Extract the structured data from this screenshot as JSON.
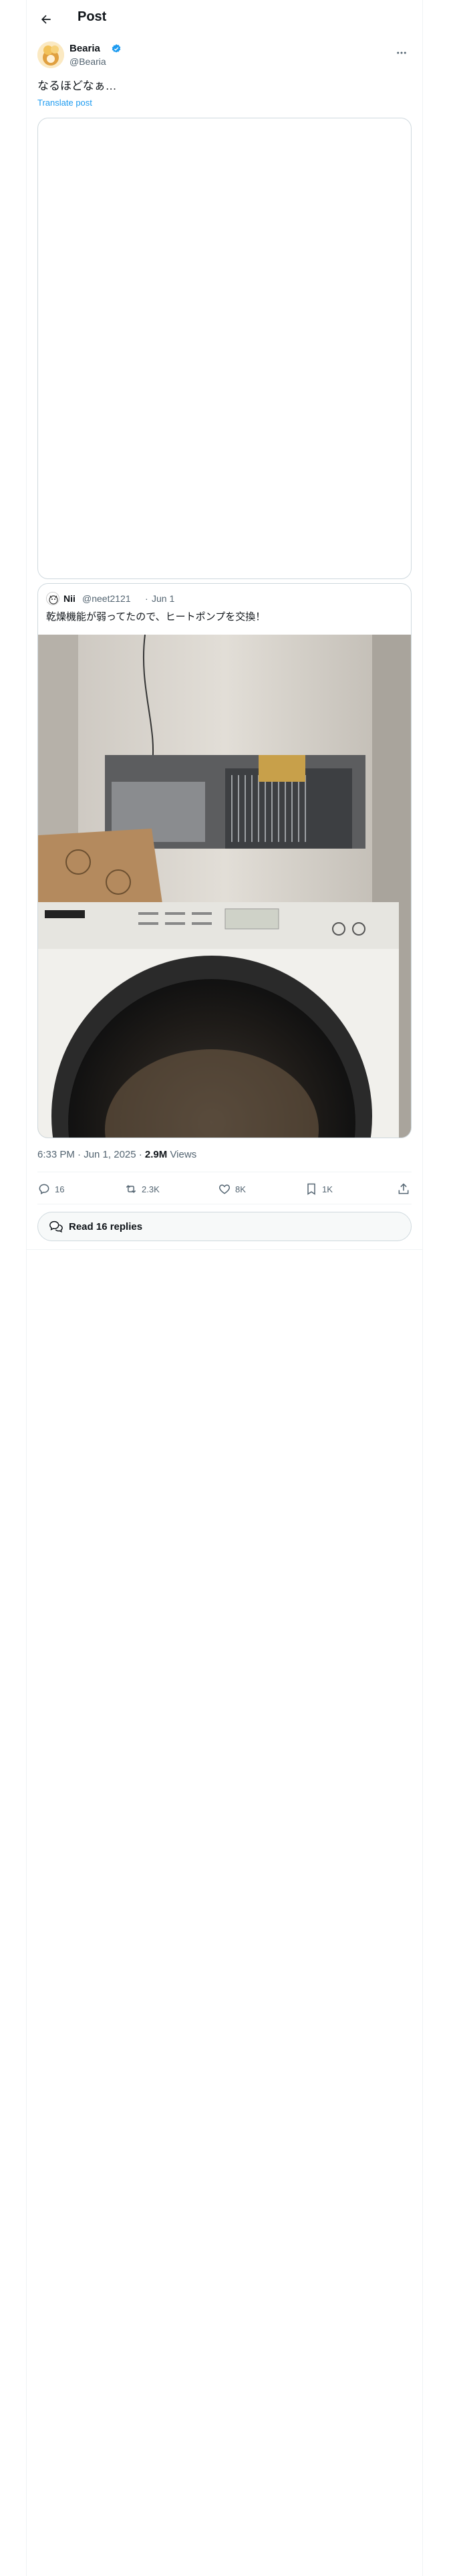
{
  "header": {
    "title": "Post"
  },
  "author": {
    "name": "Bearia",
    "handle": "@Bearia"
  },
  "post": {
    "text": "なるほどなぁ…",
    "translate_label": "Translate post"
  },
  "quote": {
    "name": "Nii",
    "handle": "@neet2121",
    "separator": "·",
    "date": "Jun 1",
    "text": "乾燥機能が弱ってたので、ヒートポンプを交換！"
  },
  "meta": {
    "time": "6:33 PM · Jun 1, 2025 · ",
    "views_count": "2.9M",
    "views_label": " Views"
  },
  "actions": {
    "replies": "16",
    "reposts": "2.3K",
    "likes": "8K",
    "bookmarks": "1K"
  },
  "read_replies": {
    "label": "Read 16 replies"
  },
  "icons": [
    "back-arrow-icon",
    "verified-badge-icon",
    "more-icon",
    "reply-icon",
    "repost-icon",
    "like-icon",
    "bookmark-icon",
    "share-icon",
    "speech-bubbles-icon"
  ],
  "colors": {
    "accent": "#1d9bf0",
    "text": "#0f1419",
    "muted": "#536471",
    "border": "#cfd9de"
  }
}
